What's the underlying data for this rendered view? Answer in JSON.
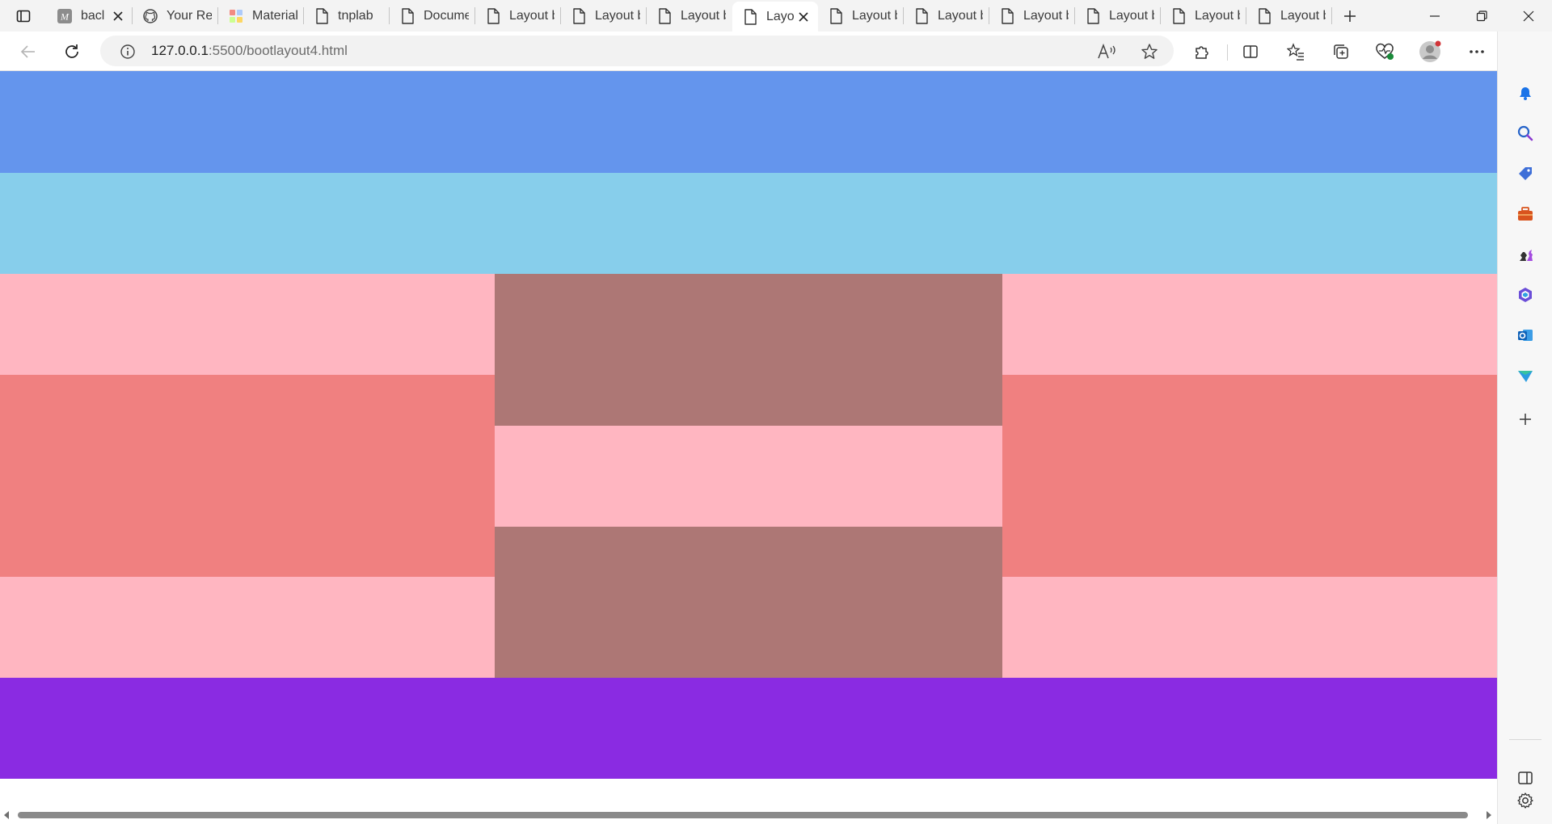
{
  "browser": {
    "tabs": [
      {
        "title": "bacl",
        "icon": "m-logo-icon",
        "active": false,
        "closable": true
      },
      {
        "title": "Your Rep",
        "icon": "github-icon",
        "active": false
      },
      {
        "title": "Material",
        "icon": "material-icon",
        "active": false
      },
      {
        "title": "tnplab",
        "icon": "page-icon",
        "active": false
      },
      {
        "title": "Documer",
        "icon": "page-icon",
        "active": false
      },
      {
        "title": "Layout b",
        "icon": "page-icon",
        "active": false
      },
      {
        "title": "Layout b",
        "icon": "page-icon",
        "active": false
      },
      {
        "title": "Layout b",
        "icon": "page-icon",
        "active": false
      },
      {
        "title": "Layo",
        "icon": "page-icon",
        "active": true,
        "closable": true
      },
      {
        "title": "Layout b",
        "icon": "page-icon",
        "active": false
      },
      {
        "title": "Layout b",
        "icon": "page-icon",
        "active": false
      },
      {
        "title": "Layout b",
        "icon": "page-icon",
        "active": false
      },
      {
        "title": "Layout b",
        "icon": "page-icon",
        "active": false
      },
      {
        "title": "Layout b",
        "icon": "page-icon",
        "active": false
      },
      {
        "title": "Layout b",
        "icon": "page-icon",
        "active": false
      }
    ],
    "address": {
      "host": "127.0.0.1",
      "path": ":5500/bootlayout4.html"
    }
  },
  "page": {
    "colors": {
      "row1": "#6495ED",
      "row2": "#87CEEB",
      "side_light": "#FFB6C1",
      "side_dark": "#F08080",
      "center_dark": "#AD7775",
      "center_light": "#FFB6C1",
      "footer": "#8A2BE2"
    }
  },
  "sidebar": {
    "items": [
      "bell-icon",
      "search-icon",
      "tag-icon",
      "toolbox-icon",
      "chess-icon",
      "office-icon",
      "outlook-icon",
      "send-icon",
      "add-icon"
    ],
    "bottom": [
      "split-panel-icon",
      "settings-icon"
    ]
  }
}
